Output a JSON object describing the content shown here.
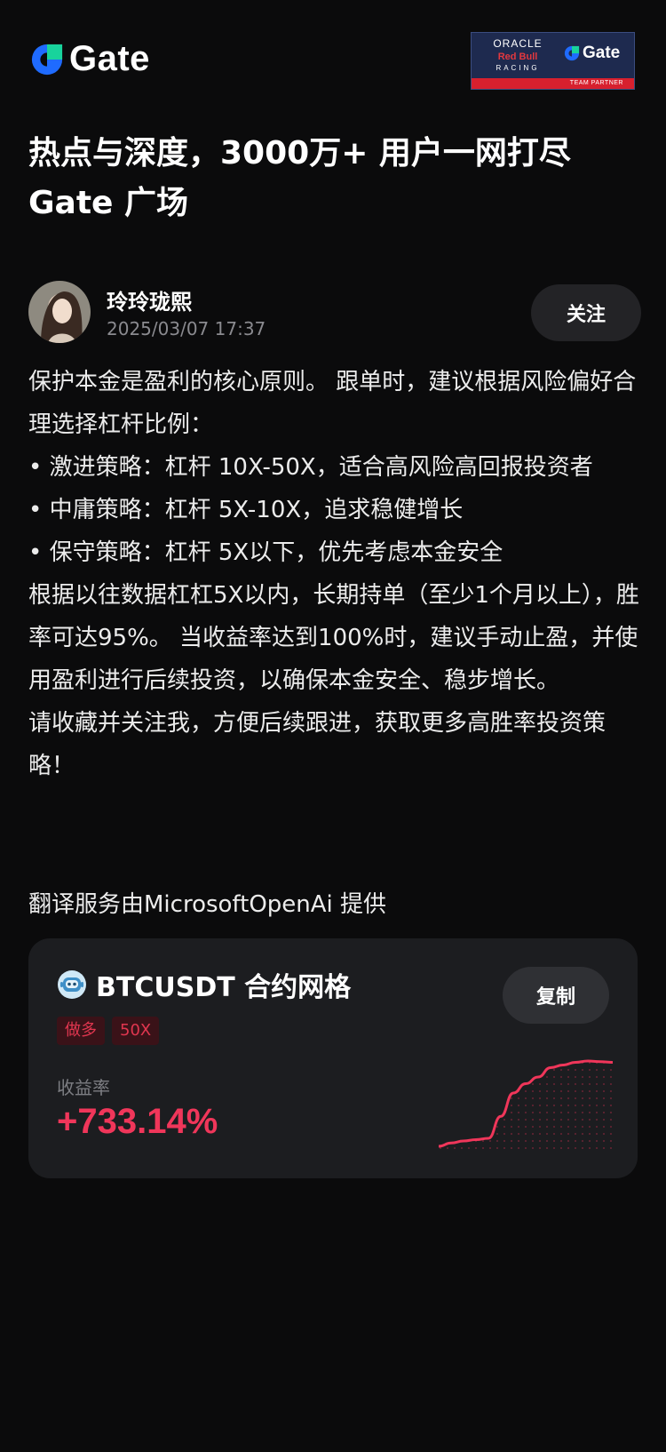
{
  "header": {
    "brand": "Gate",
    "partner": {
      "oracle": "ORACLE",
      "redbull": "Red Bull",
      "racing": "RACING",
      "brand": "Gate",
      "strip": "TEAM PARTNER"
    }
  },
  "headline": {
    "line1": "热点与深度，3000万+ 用户一网打尽",
    "line2": "Gate 广场"
  },
  "author": {
    "name": "玲玲珑熙",
    "date": "2025/03/07 17:37",
    "follow_label": "关注"
  },
  "post": {
    "paragraphs": [
      "保护本金是盈利的核心原则。 跟单时，建议根据风险偏好合理选择杠杆比例：",
      "• 激进策略：杠杆 10X-50X，适合高风险高回报投资者",
      "• 中庸策略：杠杆 5X-10X，追求稳健增长",
      "• 保守策略：杠杆 5X以下，优先考虑本金安全",
      "根据以往数据杠杠5X以内，长期持单（至少1个月以上），胜率可达95%。 当收益率达到100%时，建议手动止盈，并使用盈利进行后续投资，以确保本金安全、稳步增长。",
      "请收藏并关注我，方便后续跟进，获取更多高胜率投资策略！"
    ]
  },
  "translation_note": "翻译服务由MicrosoftOpenAi 提供",
  "card": {
    "title": "BTCUSDT 合约网格",
    "copy_label": "复制",
    "tags": [
      "做多",
      "50X"
    ],
    "roi_label": "收益率",
    "roi_value": "+733.14%",
    "accent_color": "#f0365a"
  },
  "chart_data": {
    "type": "area",
    "series": [
      {
        "values": [
          0,
          5,
          8,
          10,
          12,
          45,
          80,
          94,
          104,
          118,
          122,
          126,
          128,
          127,
          126
        ]
      }
    ]
  }
}
